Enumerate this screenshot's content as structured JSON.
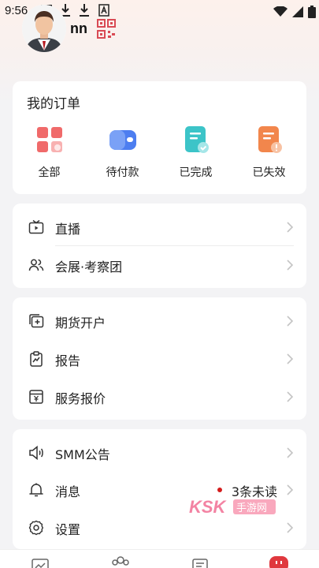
{
  "status_bar": {
    "time": "9:56"
  },
  "profile": {
    "username": "nn"
  },
  "orders": {
    "title": "我的订单",
    "items": [
      {
        "label": "全部",
        "icon": "grid-icon",
        "color": "#f06767"
      },
      {
        "label": "待付款",
        "icon": "wallet-icon",
        "color": "#4f7ff2"
      },
      {
        "label": "已完成",
        "icon": "completed-doc-icon",
        "color": "#3cc4c8"
      },
      {
        "label": "已失效",
        "icon": "expired-doc-icon",
        "color": "#f2864c"
      }
    ]
  },
  "group1": [
    {
      "label": "直播",
      "icon": "tv-icon"
    },
    {
      "label": "会展·考察团",
      "icon": "people-icon"
    }
  ],
  "group2": [
    {
      "label": "期货开户",
      "icon": "add-account-icon"
    },
    {
      "label": "报告",
      "icon": "report-icon"
    },
    {
      "label": "服务报价",
      "icon": "price-icon"
    }
  ],
  "group3": [
    {
      "label": "SMM公告",
      "icon": "speaker-icon"
    },
    {
      "label": "消息",
      "icon": "bell-icon",
      "badge": "3条未读"
    },
    {
      "label": "设置",
      "icon": "gear-icon"
    }
  ],
  "watermark": {
    "text": "KSK",
    "subtext": "手游网"
  },
  "colors": {
    "accent": "#d41c1c",
    "background": "#f3f3f5",
    "header_tint": "#fdf1ec"
  }
}
